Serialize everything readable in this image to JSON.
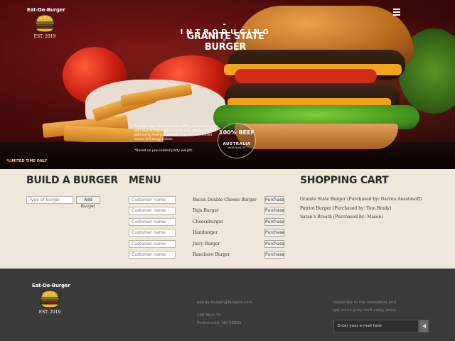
{
  "header": {
    "logo_title": "Eat-De-Burger",
    "logo_est": "EST. 2019",
    "menu_icon": "hamburger-menu-icon"
  },
  "hero": {
    "introducing": "- INTRODUCING -",
    "product_name": "GRANITE STATE BURGER",
    "description": "A double layer of sear-sizzled 100% pure beef mingled with special sauce on a sesame seed bun and topped with melty American cheese, crisp lettuce, minced onions and tangy pickles.",
    "note": "*Based on pre-cooked patty weight.",
    "limited": "*LIMITED TIME ONLY",
    "badge_top": "100% BEEF",
    "badge_mid": "AUSTRALIA",
    "badge_bottom": "HIGH QUALITY"
  },
  "build": {
    "title": "BUILD A BURGER",
    "input_placeholder": "Type of burger",
    "add_label": "Add Burger"
  },
  "menu": {
    "title": "MENU",
    "customer_placeholder": "Customer name",
    "purchase_label": "Purchase",
    "items": [
      {
        "name": "Bacon Double Cheese Burger"
      },
      {
        "name": "Baja Burger"
      },
      {
        "name": "Cheeseburger"
      },
      {
        "name": "Hamburger"
      },
      {
        "name": "Juicy Burger"
      },
      {
        "name": "Ranchero Burger"
      }
    ]
  },
  "cart": {
    "title": "SHOPPING CART",
    "items": [
      "Granite State Burger (Purchased by: Darren Anastasoff)",
      "Patriot Burger (Purchased by: Tom Brady)",
      "Satan's Breath (Purchased by: Mason)"
    ]
  },
  "footer": {
    "logo_title": "Eat-De-Burger",
    "logo_est": "EST. 2019",
    "email": "eat-da-burger@burgers.com",
    "address_line1": "100 Main St.",
    "address_line2": "Portsmouth, NH 03801",
    "newsletter_line1": "Subscribe to the newsletter and",
    "newsletter_line2": "get some juicy stuff every week.",
    "newsletter_placeholder": "Enter your e-mail here",
    "submit_icon": "send-arrow-icon"
  },
  "colors": {
    "cream": "#efe8da",
    "footer": "#3b3b3b",
    "hero_red": "#5a0e0e",
    "limited_yellow": "#f7d26a"
  }
}
